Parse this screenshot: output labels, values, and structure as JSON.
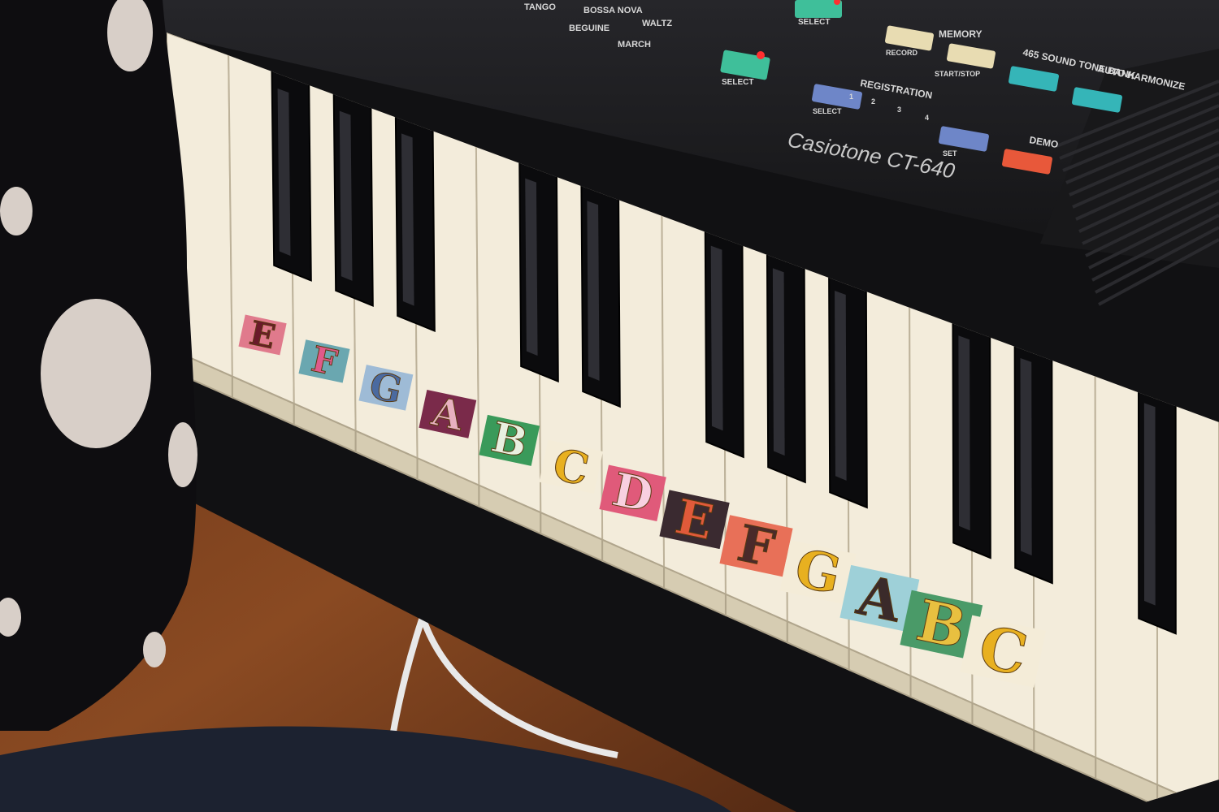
{
  "panel": {
    "rhythms": [
      "TANGO",
      "BOSSA NOVA",
      "WALTZ",
      "BEGUINE",
      "MARCH"
    ],
    "select_top_label": "SELECT",
    "select_label": "SELECT",
    "memory": {
      "title": "MEMORY",
      "record_label": "RECORD",
      "start_stop_label": "START/STOP"
    },
    "sound_bank_label": "465 SOUND  TONE BANK",
    "auto_harmonize_label": "AUTO  HARMONIZE",
    "registration": {
      "title": "REGISTRATION",
      "numbers": [
        "1",
        "2",
        "3",
        "4"
      ],
      "select_label": "SELECT",
      "set_label": "SET"
    },
    "demo_label": "DEMO",
    "brand": "Casiotone CT-640",
    "colors": {
      "body": "#1d1d20",
      "green_button": "#3fbf9a",
      "cream_button": "#e8dcb2",
      "blue_button": "#6e86c8",
      "teal_button": "#35b5b8",
      "demo_button": "#e8583a",
      "led": "#ff3030"
    }
  },
  "keyboard": {
    "key_color": "#f3ecdb",
    "black_key_color": "#0b0b0d",
    "stickers": [
      {
        "letter": "E",
        "bg": "#e07a8c",
        "fg": "#6a1a2a"
      },
      {
        "letter": "F",
        "bg": "#6aa7b0",
        "fg": "#e05a8a"
      },
      {
        "letter": "G",
        "bg": "#9ebbd6",
        "fg": "#4a6aa0"
      },
      {
        "letter": "A",
        "bg": "#7a2a4a",
        "fg": "#e8b0c0"
      },
      {
        "letter": "B",
        "bg": "#3a9a5a",
        "fg": "#e8f0e0"
      },
      {
        "letter": "C",
        "bg": "#f4ecd8",
        "fg": "#e8b020"
      },
      {
        "letter": "D",
        "bg": "#e05a7a",
        "fg": "#f8d0e0"
      },
      {
        "letter": "E",
        "bg": "#3a2a30",
        "fg": "#e05a3a"
      },
      {
        "letter": "F",
        "bg": "#e87058",
        "fg": "#4a2a2a"
      },
      {
        "letter": "G",
        "bg": "#f4ecd8",
        "fg": "#e8b020"
      },
      {
        "letter": "A",
        "bg": "#9ed0d8",
        "fg": "#3a2a2a"
      },
      {
        "letter": "B",
        "bg": "#4a9a68",
        "fg": "#e8c040"
      },
      {
        "letter": "C",
        "bg": "#f4ecd8",
        "fg": "#e8b020"
      }
    ]
  }
}
